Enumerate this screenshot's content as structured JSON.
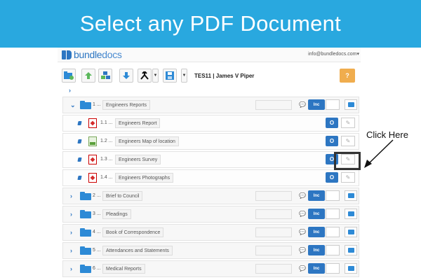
{
  "banner": {
    "title": "Select any PDF Document"
  },
  "app": {
    "logo": {
      "part1": "bundle",
      "part2": "docs"
    },
    "account": "info@bundledocs.com",
    "account_caret": "▾",
    "case_title": "TES11 | James V Piper",
    "help_label": "?"
  },
  "tree": {
    "sections": [
      {
        "number": "1 ...",
        "label": "Engineers Reports",
        "expanded": true,
        "inc": "Inc"
      },
      {
        "number": "2 ...",
        "label": "Brief to Council",
        "expanded": false,
        "inc": "Inc"
      },
      {
        "number": "3 ...",
        "label": "Pleadings",
        "expanded": false,
        "inc": "Inc"
      },
      {
        "number": "4 ...",
        "label": "Book of Correspondence",
        "expanded": false,
        "inc": "Inc"
      },
      {
        "number": "5 ...",
        "label": "Attendances and Statements",
        "expanded": false,
        "inc": "Inc"
      },
      {
        "number": "6 ...",
        "label": "Medical Reports",
        "expanded": false,
        "inc": "Inc"
      }
    ],
    "documents": [
      {
        "number": "1.1 ...",
        "label": "Engineers Report",
        "type": "pdf",
        "o": "O"
      },
      {
        "number": "1.2 ...",
        "label": "Engineers Map of location",
        "type": "image",
        "o": "O"
      },
      {
        "number": "1.3 ...",
        "label": "Engineers Survey",
        "type": "pdf",
        "o": "O"
      },
      {
        "number": "1.4 ...",
        "label": "Engineers Photographs",
        "type": "pdf",
        "o": "O"
      }
    ]
  },
  "annotation": {
    "callout": "Click Here"
  },
  "colors": {
    "banner": "#29a8df",
    "primary": "#2d76c2",
    "help": "#f0ad4e"
  }
}
